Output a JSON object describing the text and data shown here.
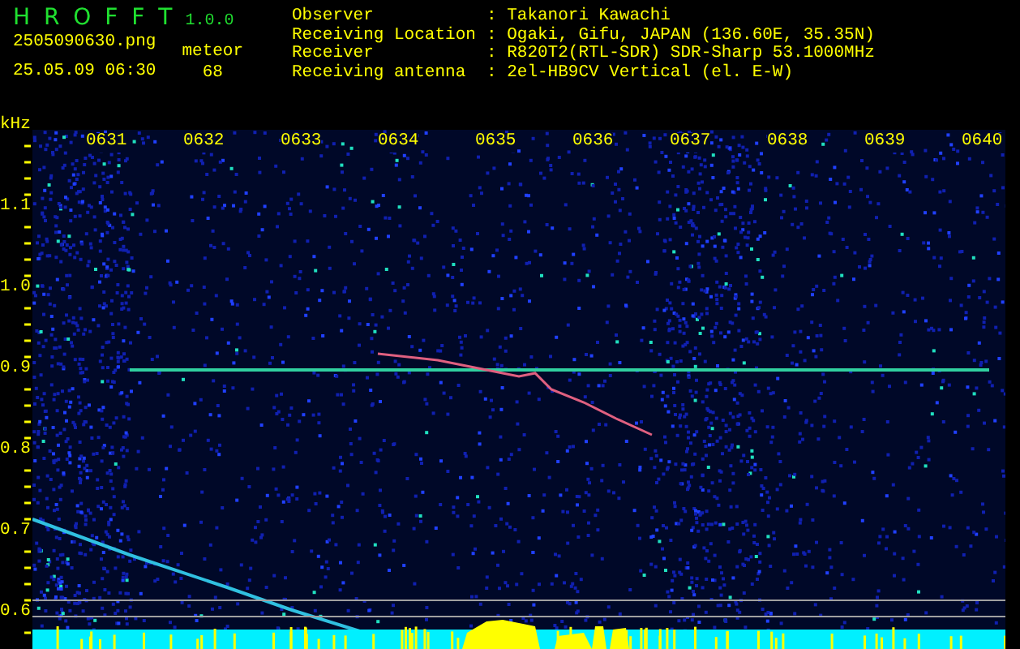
{
  "app": {
    "name": "H R O F F T",
    "version": "1.0.0"
  },
  "file": {
    "filename": "2505090630.png",
    "datetime": "25.05.09 06:30"
  },
  "meteor": {
    "label": "meteor",
    "count": "68"
  },
  "info": [
    {
      "label": "Observer",
      "value": ": Takanori Kawachi"
    },
    {
      "label": "Receiving Location",
      "value": ": Ogaki, Gifu, JAPAN (136.60E, 35.35N)"
    },
    {
      "label": "Receiver",
      "value": ": R820T2(RTL-SDR) SDR-Sharp 53.1000MHz"
    },
    {
      "label": "Receiving antenna",
      "value": ": 2el-HB9CV Vertical (el. E-W)"
    }
  ],
  "spectrogram": {
    "unit": "kHz",
    "x_labels": [
      "0631",
      "0632",
      "0633",
      "0634",
      "0635",
      "0636",
      "0637",
      "0638",
      "0639",
      "0640"
    ],
    "y_labels": [
      "1.1",
      "1.0",
      "0.9",
      "0.8",
      "0.7",
      "0.6"
    ]
  }
}
